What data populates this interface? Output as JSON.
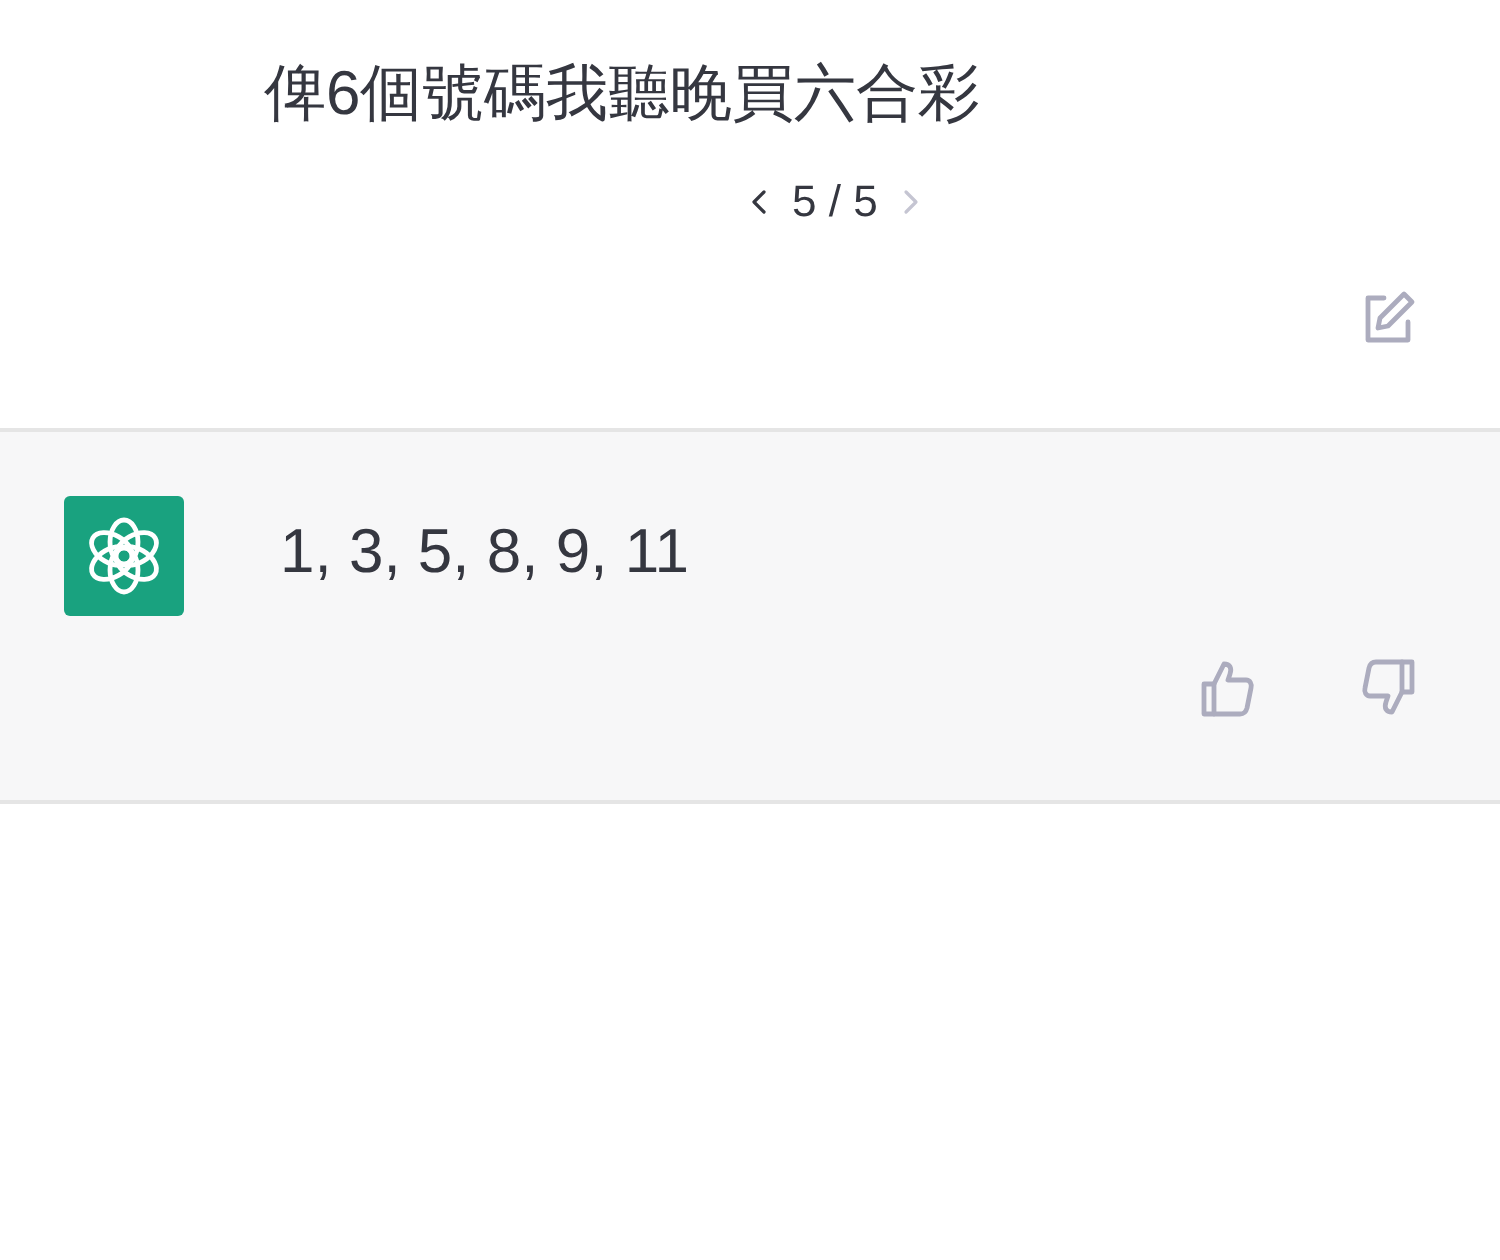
{
  "user_message": {
    "text": "俾6個號碼我聽晚買六合彩",
    "pager": {
      "label": "5 / 5",
      "prev_disabled": false,
      "next_disabled": true
    }
  },
  "assistant_message": {
    "text": "1, 3, 5, 8, 9, 11"
  }
}
